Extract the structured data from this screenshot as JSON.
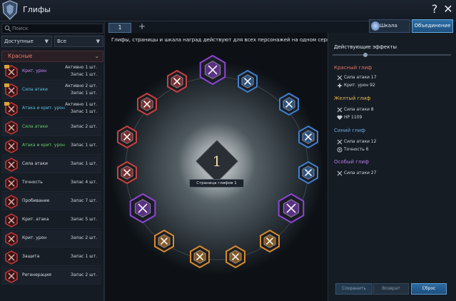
{
  "window": {
    "title": "Глифы"
  },
  "tabs": [
    {
      "label": "1"
    }
  ],
  "toolbar": {
    "add_tab": "+",
    "reward_label": "Шкала наград",
    "merge_label": "Объединение",
    "help": "?",
    "close": "✕"
  },
  "left": {
    "search_placeholder": "Поиск",
    "filter1": "Доступные",
    "filter2": "Все",
    "category": "Красные",
    "items": [
      {
        "name": "Крит. урон",
        "name_color": "purple",
        "s1": "Активно 1 шт.",
        "s2": "Запас 1 шт.",
        "icon_color": "#c43a3a",
        "badge": true
      },
      {
        "name": "Сила атаки",
        "name_color": "cyan",
        "s1": "Активно 2 шт.",
        "s2": "Запас 1 шт.",
        "icon_color": "#c43a3a",
        "badge": true
      },
      {
        "name": "Атака и крит. урон",
        "name_color": "cyan",
        "s1": "Активно 1 шт.",
        "s2": "Запас 1 шт.",
        "icon_color": "#c43a3a",
        "badge": true
      },
      {
        "name": "Сила атаки",
        "name_color": "green",
        "s": "Запас 2 шт.",
        "icon_color": "#c43a3a"
      },
      {
        "name": "Атака и крит. урон",
        "name_color": "green",
        "s": "Запас 1 шт.",
        "icon_color": "#c43a3a"
      },
      {
        "name": "Сила атаки",
        "name_color": "white",
        "s": "Запас 1 шт.",
        "icon_color": "#c43a3a"
      },
      {
        "name": "Точность",
        "name_color": "white",
        "s": "Запас 4 шт.",
        "icon_color": "#c43a3a"
      },
      {
        "name": "Пробивание",
        "name_color": "white",
        "s": "Запас 7 шт.",
        "icon_color": "#c43a3a"
      },
      {
        "name": "Крит. атака",
        "name_color": "white",
        "s": "Запас 5 шт.",
        "icon_color": "#c43a3a"
      },
      {
        "name": "Крит. урон",
        "name_color": "white",
        "s": "Запас 2 шт.",
        "icon_color": "#c43a3a"
      },
      {
        "name": "Защита",
        "name_color": "white",
        "s": "Запас 1 шт.",
        "icon_color": "#c43a3a"
      },
      {
        "name": "Регенерация",
        "name_color": "white",
        "s": "Запас 2 шт.",
        "icon_color": "#c43a3a"
      }
    ]
  },
  "center": {
    "info": "Глифы, страницы и шкала наград действуют для всех персонажей на одном сервере.",
    "page_number": "1",
    "page_label": "Страница глифов 1"
  },
  "right": {
    "title": "Действующие эффекты",
    "groups": [
      {
        "title": "Красный глиф",
        "color": "#e07564",
        "lines": [
          {
            "text": "Сила атаки 17",
            "icon": "swords-icon"
          },
          {
            "text": "Крит. урон 92",
            "icon": "crit-icon"
          }
        ]
      },
      {
        "title": "Желтый глиф",
        "color": "#e6b84f",
        "lines": [
          {
            "text": "Сила атаки 8",
            "icon": "swords-icon"
          },
          {
            "text": "HP 1109",
            "icon": "heart-icon"
          }
        ]
      },
      {
        "title": "Синий глиф",
        "color": "#66a7e4",
        "lines": [
          {
            "text": "Сила атаки 12",
            "icon": "swords-icon"
          },
          {
            "text": "Точность 6",
            "icon": "target-icon"
          }
        ]
      },
      {
        "title": "Особый глиф",
        "color": "#b479e8",
        "lines": [
          {
            "text": "Сила атаки 27",
            "icon": "swords-icon"
          }
        ]
      }
    ],
    "save_label": "Сохранить",
    "back_label": "Возврат",
    "reset_label": "Сброс"
  },
  "colors": {
    "red": "#c94040",
    "yellow": "#d98a2b",
    "blue": "#3f7fd0",
    "purple": "#8c46d6"
  }
}
